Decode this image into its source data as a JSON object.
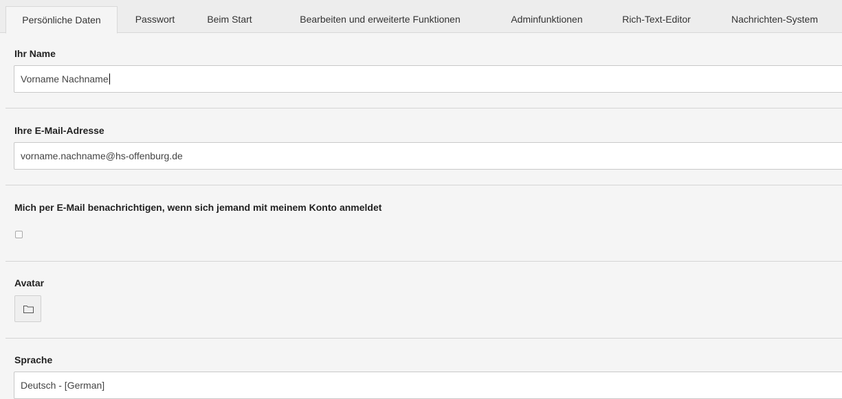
{
  "tabs": [
    {
      "label": "Persönliche Daten",
      "active": true
    },
    {
      "label": "Passwort",
      "active": false
    },
    {
      "label": "Beim Start",
      "active": false
    },
    {
      "label": "Bearbeiten und erweiterte Funktionen",
      "active": false
    },
    {
      "label": "Adminfunktionen",
      "active": false
    },
    {
      "label": "Rich-Text-Editor",
      "active": false
    },
    {
      "label": "Nachrichten-System",
      "active": false
    }
  ],
  "form": {
    "name": {
      "label": "Ihr Name",
      "value": "Vorname Nachname"
    },
    "email": {
      "label": "Ihre E-Mail-Adresse",
      "value": "vorname.nachname@hs-offenburg.de"
    },
    "notify": {
      "label": "Mich per E-Mail benachrichtigen, wenn sich jemand mit meinem Konto anmeldet",
      "checked": false
    },
    "avatar": {
      "label": "Avatar",
      "button_icon": "folder-icon"
    },
    "language": {
      "label": "Sprache",
      "value": "Deutsch - [German]"
    }
  }
}
